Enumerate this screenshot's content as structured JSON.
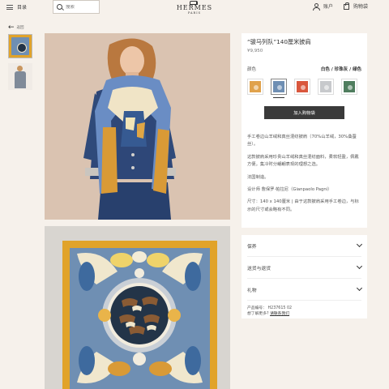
{
  "header": {
    "menu_label": "目录",
    "search_placeholder": "搜索",
    "logo_name": "HERMES",
    "logo_city": "PARIS",
    "account_label": "账户",
    "cart_label": "购物袋"
  },
  "nav": {
    "back_label": "返回"
  },
  "product": {
    "title": "“骏马列队”140厘米披肩",
    "price": "¥9,950",
    "color_label": "颜色",
    "color_value": "白色 / 珍珠灰 / 绿色",
    "swatches": [
      {
        "name": "swatch-orange",
        "color": "#e0a24c"
      },
      {
        "name": "swatch-blue-gold",
        "color": "#6f8fb3"
      },
      {
        "name": "swatch-red",
        "color": "#d9573d"
      },
      {
        "name": "swatch-grey",
        "color": "#c7c9cc"
      },
      {
        "name": "swatch-green",
        "color": "#4f7d5e"
      }
    ],
    "selected_swatch": 1,
    "add_to_bag": "加入购物袋",
    "desc": {
      "p1": "手工卷边山羊绒和真丝混纺披肩（70%山羊绒，30%桑蚕丝）。",
      "p2": "这款披肩采用珍贵山羊绒和真丝混纺面料，柔软轻盈，佩戴方便。集冷时分翩翩表现的理想之选。",
      "p3": "法国制造。",
      "p4": "设计师 詹保罗·帕拉尼（Gianpaolo Pagni）",
      "p5": "尺寸：140 x 140厘米 | 由于这款披肩采用手工卷边，与标示的尺寸或会略有不同。"
    }
  },
  "accordion": {
    "items": [
      "保养",
      "送货与退货",
      "礼物"
    ],
    "ref_label": "产品编号：",
    "ref_value": "H237615 02",
    "help_text": "想了解更多?",
    "contact_link": "请联系我们"
  },
  "colors": {
    "background": "#f6f1eb",
    "button": "#3a3a3a",
    "scarf_frame": "#e1a32a",
    "scarf_field": "#6f8fb3",
    "scarf_center": "#233448"
  }
}
